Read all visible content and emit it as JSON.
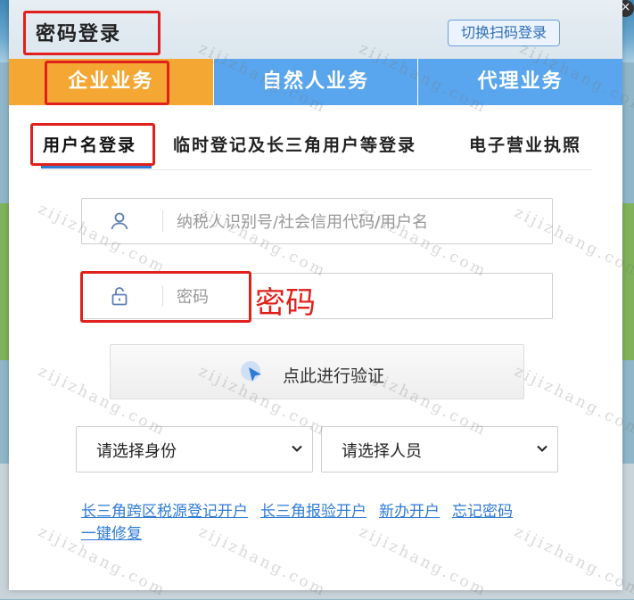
{
  "modal": {
    "title": "密码登录",
    "qr_switch_label": "切换扫码登录",
    "close_glyph": "×"
  },
  "tabs": [
    {
      "label": "企业业务",
      "active": true
    },
    {
      "label": "自然人业务",
      "active": false
    },
    {
      "label": "代理业务",
      "active": false
    }
  ],
  "subtabs": [
    {
      "label": "用户名登录",
      "active": true
    },
    {
      "label": "临时登记及长三角用户等登录",
      "active": false
    },
    {
      "label": "电子营业执照",
      "active": false
    }
  ],
  "username": {
    "placeholder": "纳税人识别号/社会信用代码/用户名",
    "value": "",
    "icon": "user-icon"
  },
  "password": {
    "placeholder": "密码",
    "value": "",
    "icon": "lock-icon"
  },
  "annotation": {
    "password_label": "密码"
  },
  "verify": {
    "label": "点此进行验证",
    "icon": "pointer-icon"
  },
  "selects": {
    "identity": "请选择身份",
    "person": "请选择人员"
  },
  "links": [
    "长三角跨区税源登记开户",
    "长三角报验开户",
    "新办开户",
    "忘记密码",
    "一键修复"
  ],
  "watermark": "zijizhang.com",
  "colors": {
    "active_tab": "#f5a733",
    "tab": "#5aa6ee",
    "link": "#2f7bd6",
    "annotation": "#e0201c"
  }
}
